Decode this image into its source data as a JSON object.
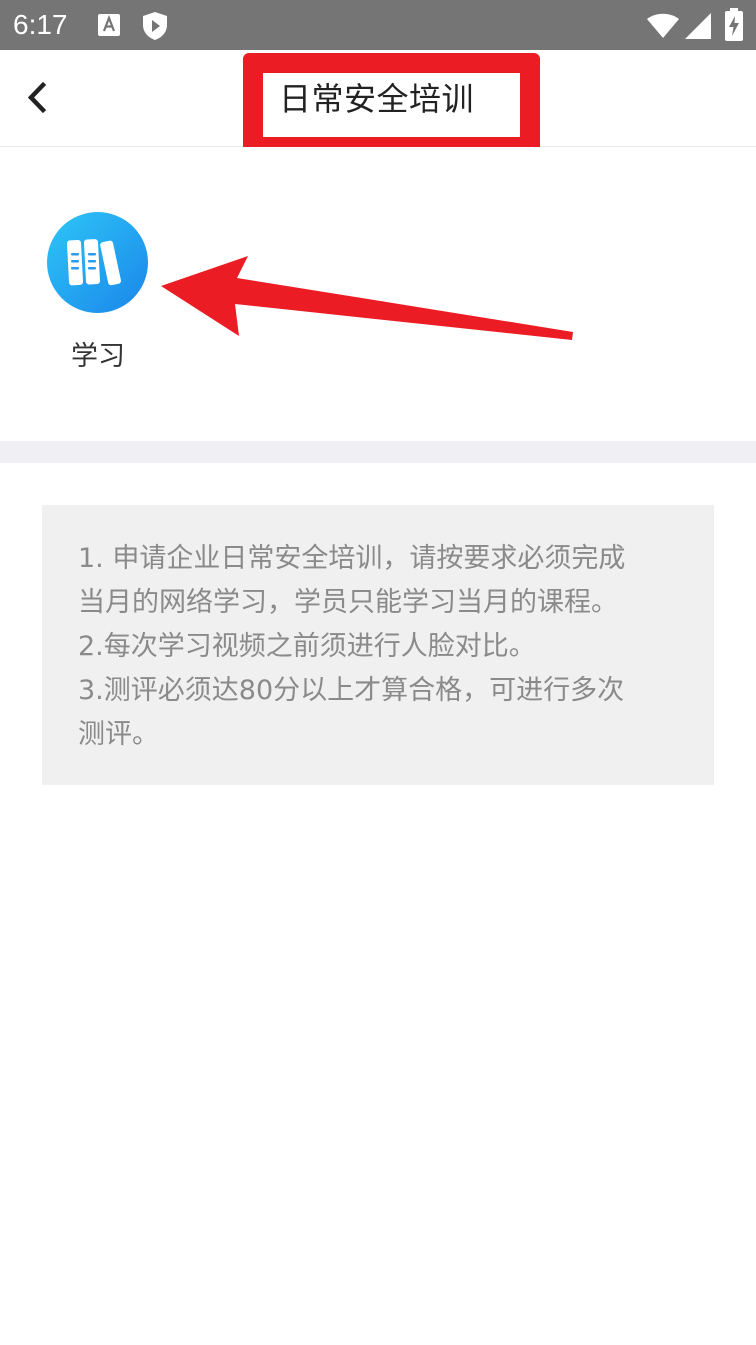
{
  "status_bar": {
    "time": "6:17",
    "icons": [
      "font-a-icon",
      "shield-play-icon",
      "wifi-icon",
      "signal-icon",
      "battery-charging-icon"
    ]
  },
  "header": {
    "back_icon": "chevron-left-icon",
    "title": "日常安全培训"
  },
  "entries": [
    {
      "icon": "books-icon",
      "label": "学习"
    }
  ],
  "notice": {
    "lines": [
      "1. 申请企业日常安全培训，请按要求必须完成",
      "当月的网络学习，学员只能学习当月的课程。",
      "2.每次学习视频之前须进行人脸对比。",
      "3.测评必须达80分以上才算合格，可进行多次",
      "测评。"
    ]
  },
  "colors": {
    "status_bar": "#757575",
    "annotation_red": "#ec1c24",
    "icon_gradient_start": "#2ec6f7",
    "icon_gradient_end": "#1a86ea",
    "divider": "#efeff4",
    "notice_background": "#f0f0f0",
    "notice_text": "#8a8a8a"
  }
}
